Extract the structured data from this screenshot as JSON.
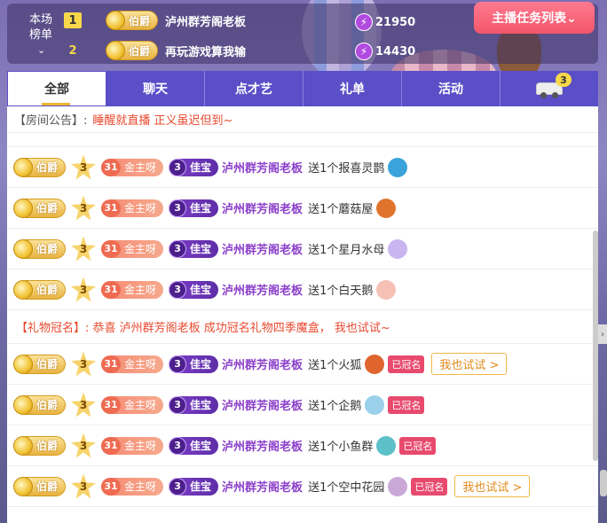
{
  "rank": {
    "title_line1": "本场",
    "title_line2": "榜单",
    "chevron": "⌄",
    "entries": [
      {
        "rank": "1",
        "noble": "伯爵",
        "name": "泸州群芳阁老板",
        "score": "21950"
      },
      {
        "rank": "2",
        "noble": "伯爵",
        "name": "再玩游戏算我输",
        "score": "14430"
      }
    ],
    "task_button": "主播任务列表⌄"
  },
  "tabs": [
    {
      "label": "全部"
    },
    {
      "label": "聊天"
    },
    {
      "label": "点才艺"
    },
    {
      "label": "礼单"
    },
    {
      "label": "活动"
    },
    {
      "label": "",
      "badge": "3"
    }
  ],
  "notice": {
    "label": "【房间公告】:",
    "text": "睡醒就直播 正义虽迟但到~"
  },
  "messages": [
    {
      "noble": "伯爵",
      "star": "3",
      "fan_lvl": "31",
      "fan": "金主呀",
      "treasure_lvl": "3",
      "treasure": "佳宝",
      "user": "泸州群芳阁老板",
      "text": "送1个报喜灵鹊",
      "gift_color": "#3aa3d9"
    },
    {
      "noble": "伯爵",
      "star": "3",
      "fan_lvl": "31",
      "fan": "金主呀",
      "treasure_lvl": "3",
      "treasure": "佳宝",
      "user": "泸州群芳阁老板",
      "text": "送1个蘑菇屋",
      "gift_color": "#e0742e"
    },
    {
      "noble": "伯爵",
      "star": "3",
      "fan_lvl": "31",
      "fan": "金主呀",
      "treasure_lvl": "3",
      "treasure": "佳宝",
      "user": "泸州群芳阁老板",
      "text": "送1个星月水母",
      "gift_color": "#c9b6f0"
    },
    {
      "noble": "伯爵",
      "star": "3",
      "fan_lvl": "31",
      "fan": "金主呀",
      "treasure_lvl": "3",
      "treasure": "佳宝",
      "user": "泸州群芳阁老板",
      "text": "送1个白天鹅",
      "gift_color": "#f6c0b5"
    }
  ],
  "system": "【礼物冠名】: 恭喜 泸州群芳阁老板 成功冠名礼物四季魔盒， 我也试试~",
  "crowned_messages": [
    {
      "noble": "伯爵",
      "star": "3",
      "fan_lvl": "31",
      "fan": "金主呀",
      "treasure_lvl": "3",
      "treasure": "佳宝",
      "user": "泸州群芳阁老板",
      "text": "送1个火狐",
      "gift_color": "#e0642e",
      "crowned": "已冠名",
      "try": "我也试试 >"
    },
    {
      "noble": "伯爵",
      "star": "3",
      "fan_lvl": "31",
      "fan": "金主呀",
      "treasure_lvl": "3",
      "treasure": "佳宝",
      "user": "泸州群芳阁老板",
      "text": "送1个企鹅",
      "gift_color": "#9ad0ea",
      "crowned": "已冠名",
      "try": ""
    },
    {
      "noble": "伯爵",
      "star": "3",
      "fan_lvl": "31",
      "fan": "金主呀",
      "treasure_lvl": "3",
      "treasure": "佳宝",
      "user": "泸州群芳阁老板",
      "text": "送1个小鱼群",
      "gift_color": "#5cc0c8",
      "crowned": "已冠名",
      "try": ""
    },
    {
      "noble": "伯爵",
      "star": "3",
      "fan_lvl": "31",
      "fan": "金主呀",
      "treasure_lvl": "3",
      "treasure": "佳宝",
      "user": "泸州群芳阁老板",
      "text": "送1个空中花园",
      "gift_color": "#c9a8d8",
      "crowned": "已冠名",
      "try": "我也试试 >"
    }
  ]
}
